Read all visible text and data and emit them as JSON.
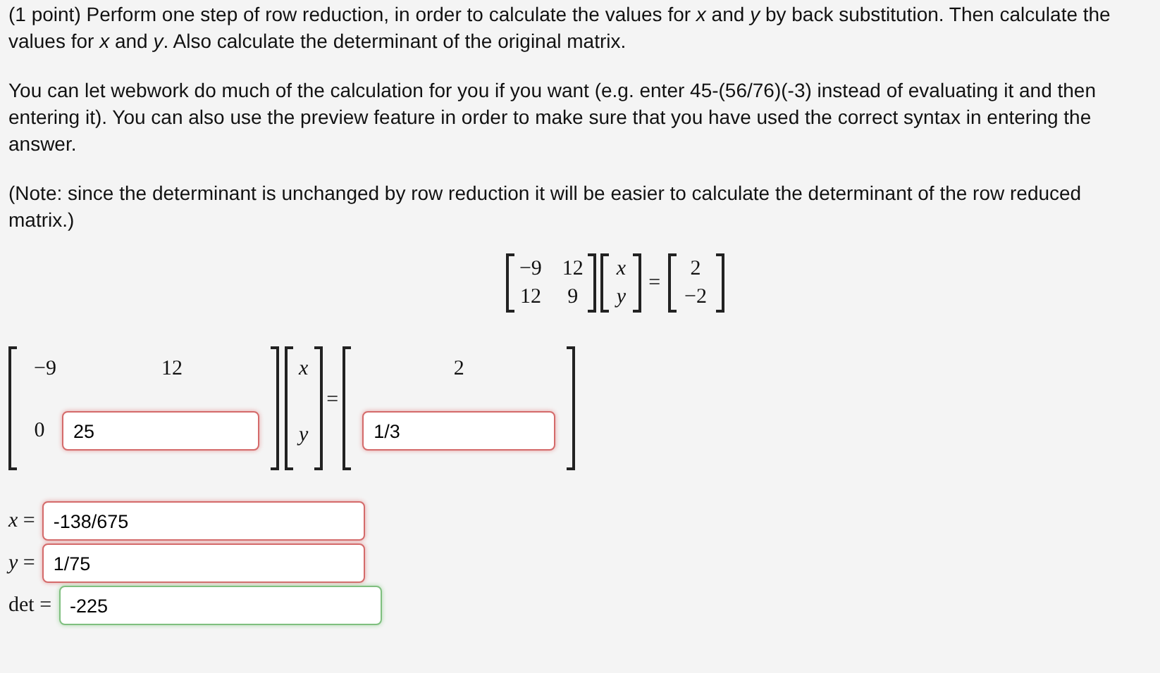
{
  "problem": {
    "paragraphs": [
      "(1 point) Perform one step of row reduction, in order to calculate the values for *x* and *y* by back substitution. Then calculate the values for *x* and *y*. Also calculate the determinant of the original matrix.",
      "You can let webwork do much of the calculation for you if you want (e.g. enter 45-(56/76)(-3) instead of evaluating it and then entering it). You can also use the preview feature in order to make sure that you have used the correct syntax in entering the answer.",
      "(Note: since the determinant is unchanged by row reduction it will be easier to calculate the determinant of the row reduced matrix.)"
    ]
  },
  "system": {
    "matrix": [
      [
        "−9",
        "12"
      ],
      [
        "12",
        "9"
      ]
    ],
    "vector": [
      "x",
      "y"
    ],
    "equals": "=",
    "rhs": [
      "2",
      "−2"
    ]
  },
  "answer_system": {
    "row_1": [
      "−9",
      "12"
    ],
    "row_2_lead": "0",
    "row_2_field": {
      "value": "25",
      "correct": false
    },
    "vector": [
      "x",
      "y"
    ],
    "equals": "=",
    "rhs_1": "2",
    "rhs_2_field": {
      "value": "1/3",
      "correct": false
    }
  },
  "results": [
    {
      "label": "*x* =",
      "value": "-138/675",
      "correct": false
    },
    {
      "label": "*y* =",
      "value": "1/75",
      "correct": false
    },
    {
      "label": "det =",
      "value": "-225",
      "correct": true
    }
  ]
}
